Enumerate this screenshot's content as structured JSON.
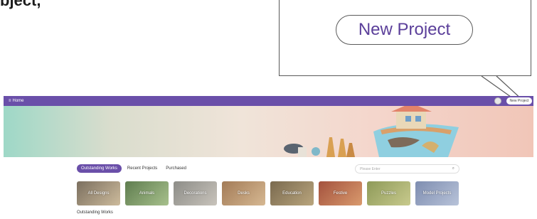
{
  "top_fragment": "bject,",
  "callout": {
    "label": "New Project"
  },
  "navbar": {
    "home_label": "Home",
    "new_project_label": "New Project",
    "color": "#6a4fa9"
  },
  "tabs": [
    {
      "label": "Outstanding Works",
      "active": true
    },
    {
      "label": "Recent Projects",
      "active": false
    },
    {
      "label": "Purchased",
      "active": false
    }
  ],
  "search": {
    "placeholder": "Please Enter",
    "icon": "search-icon"
  },
  "categories": [
    {
      "label": "All Designs"
    },
    {
      "label": "Animals"
    },
    {
      "label": "Decorations"
    },
    {
      "label": "Desks"
    },
    {
      "label": "Education"
    },
    {
      "label": "Festive"
    },
    {
      "label": "Puzzles"
    },
    {
      "label": "Model Projects"
    }
  ],
  "section_title": "Outstanding Works"
}
